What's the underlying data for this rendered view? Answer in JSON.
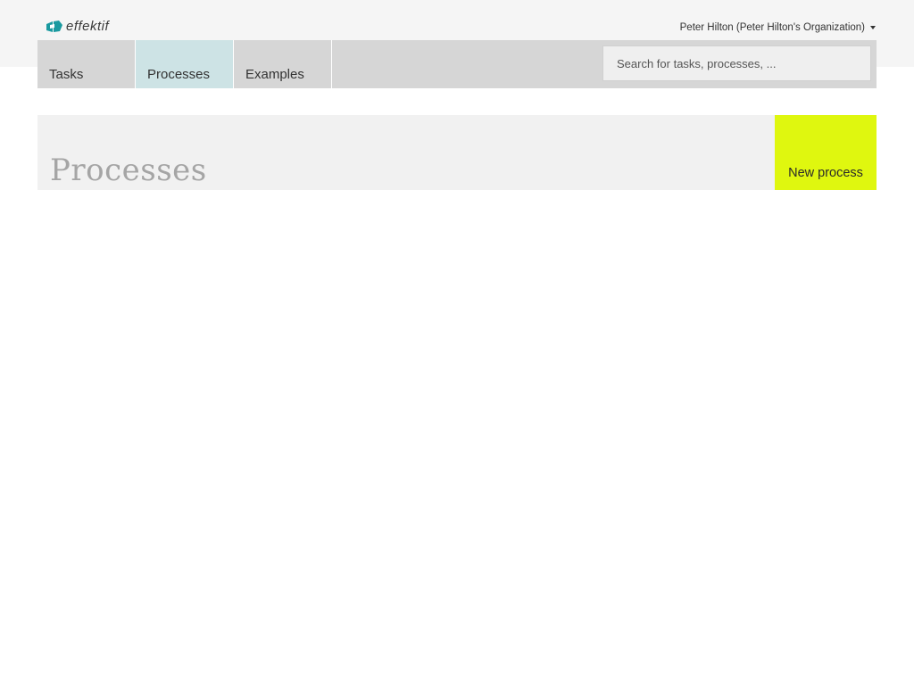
{
  "brand": {
    "logo_text": "effektif",
    "logo_icon": "effektif-logo-icon",
    "accent_color": "#1a9aa0"
  },
  "user_menu": {
    "label": "Peter Hilton (Peter Hilton's Organization)",
    "icon": "caret-down-icon"
  },
  "nav": {
    "tabs": [
      {
        "label": "Tasks",
        "active": false
      },
      {
        "label": "Processes",
        "active": true
      },
      {
        "label": "Examples",
        "active": false
      }
    ],
    "active_color": "#cde3e5"
  },
  "search": {
    "placeholder": "Search for tasks, processes, ...",
    "value": ""
  },
  "page": {
    "title": "Processes"
  },
  "actions": {
    "new_process_label": "New process",
    "new_process_color": "#dff70f"
  }
}
